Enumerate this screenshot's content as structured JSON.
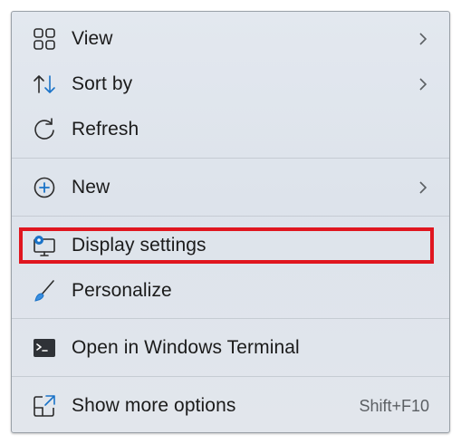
{
  "menu": {
    "items": [
      {
        "label": "View",
        "icon": "grid-icon",
        "submenu": true
      },
      {
        "label": "Sort by",
        "icon": "sort-arrows-icon",
        "submenu": true
      },
      {
        "label": "Refresh",
        "icon": "refresh-icon",
        "submenu": false
      },
      {
        "label": "New",
        "icon": "plus-circle-icon",
        "submenu": true
      },
      {
        "label": "Display settings",
        "icon": "display-settings-icon",
        "submenu": false
      },
      {
        "label": "Personalize",
        "icon": "brush-icon",
        "submenu": false
      },
      {
        "label": "Open in Windows Terminal",
        "icon": "terminal-icon",
        "submenu": false
      },
      {
        "label": "Show more options",
        "icon": "show-more-icon",
        "submenu": false,
        "shortcut": "Shift+F10"
      }
    ]
  },
  "colors": {
    "highlight_border": "#e0161f",
    "accent": "#1a73c8"
  }
}
